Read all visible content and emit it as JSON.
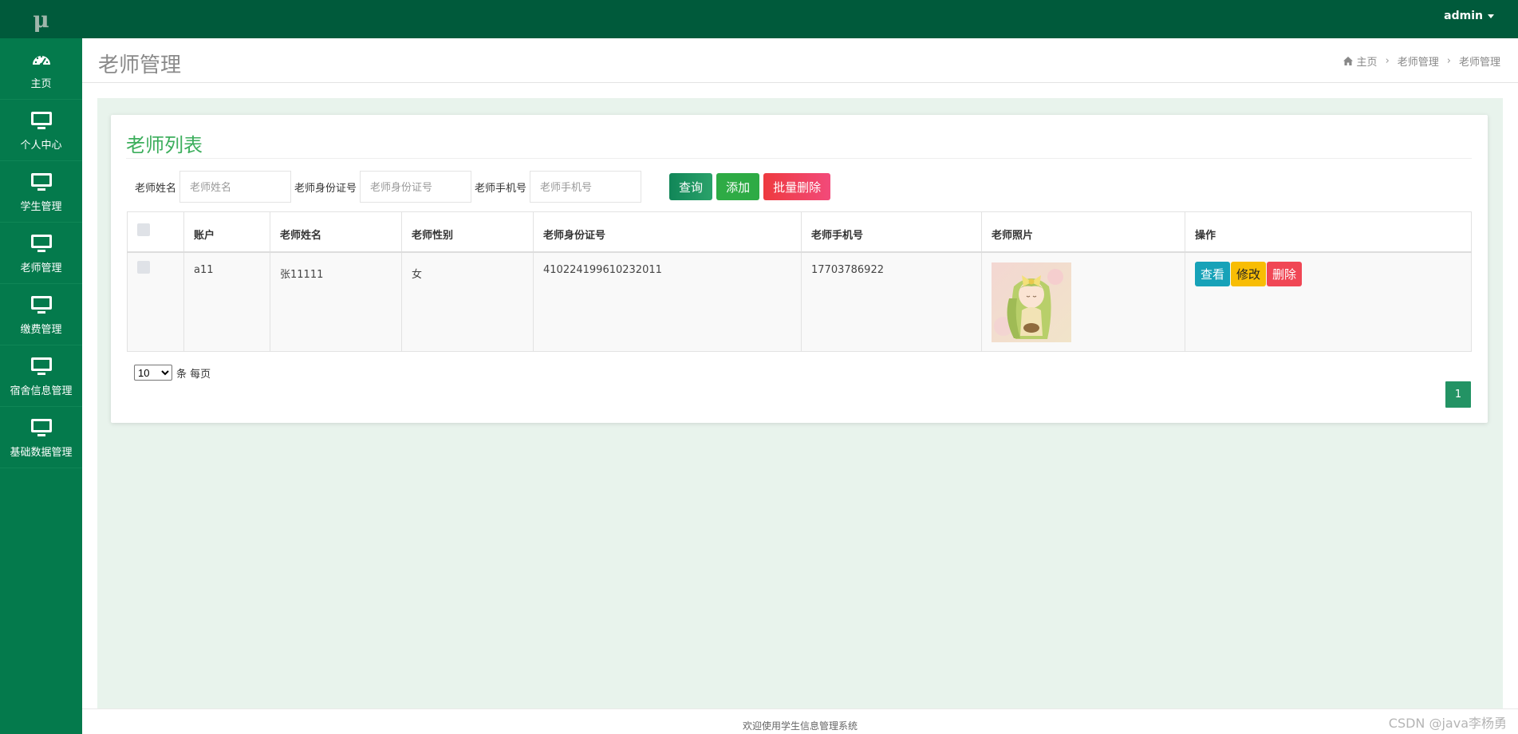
{
  "app": {
    "logo_text": "μ",
    "user": "admin"
  },
  "sidebar": {
    "items": [
      {
        "label": "主页",
        "icon": "dashboard-icon"
      },
      {
        "label": "个人中心",
        "icon": "monitor-icon"
      },
      {
        "label": "学生管理",
        "icon": "monitor-icon"
      },
      {
        "label": "老师管理",
        "icon": "monitor-icon"
      },
      {
        "label": "缴费管理",
        "icon": "monitor-icon"
      },
      {
        "label": "宿舍信息管理",
        "icon": "monitor-icon"
      },
      {
        "label": "基础数据管理",
        "icon": "monitor-icon"
      }
    ]
  },
  "header": {
    "title": "老师管理",
    "breadcrumb": [
      "主页",
      "老师管理",
      "老师管理"
    ]
  },
  "card": {
    "title": "老师列表",
    "search": {
      "name_label": "老师姓名",
      "name_placeholder": "老师姓名",
      "id_label": "老师身份证号",
      "id_placeholder": "老师身份证号",
      "phone_label": "老师手机号",
      "phone_placeholder": "老师手机号"
    },
    "buttons": {
      "query": "查询",
      "add": "添加",
      "batch_delete": "批量删除"
    }
  },
  "table": {
    "headers": [
      "账户",
      "老师姓名",
      "老师性别",
      "老师身份证号",
      "老师手机号",
      "老师照片",
      "操作"
    ],
    "rows": [
      {
        "account": "a11",
        "name": "张11111",
        "gender": "女",
        "id_number": "410224199610232011",
        "phone": "17703786922",
        "actions": {
          "view": "查看",
          "edit": "修改",
          "delete": "删除"
        }
      }
    ]
  },
  "pagination": {
    "page_size": "10",
    "page_size_options": [
      "10"
    ],
    "page_size_suffix": "条 每页",
    "current_page": "1"
  },
  "footer": {
    "text": "欢迎使用学生信息管理系统",
    "watermark": "CSDN @java李杨勇"
  },
  "colors": {
    "sidebar": "#047a4c",
    "topbar": "#005a3b",
    "accent": "#3cae5c",
    "content_bg": "#e8f3ec"
  }
}
